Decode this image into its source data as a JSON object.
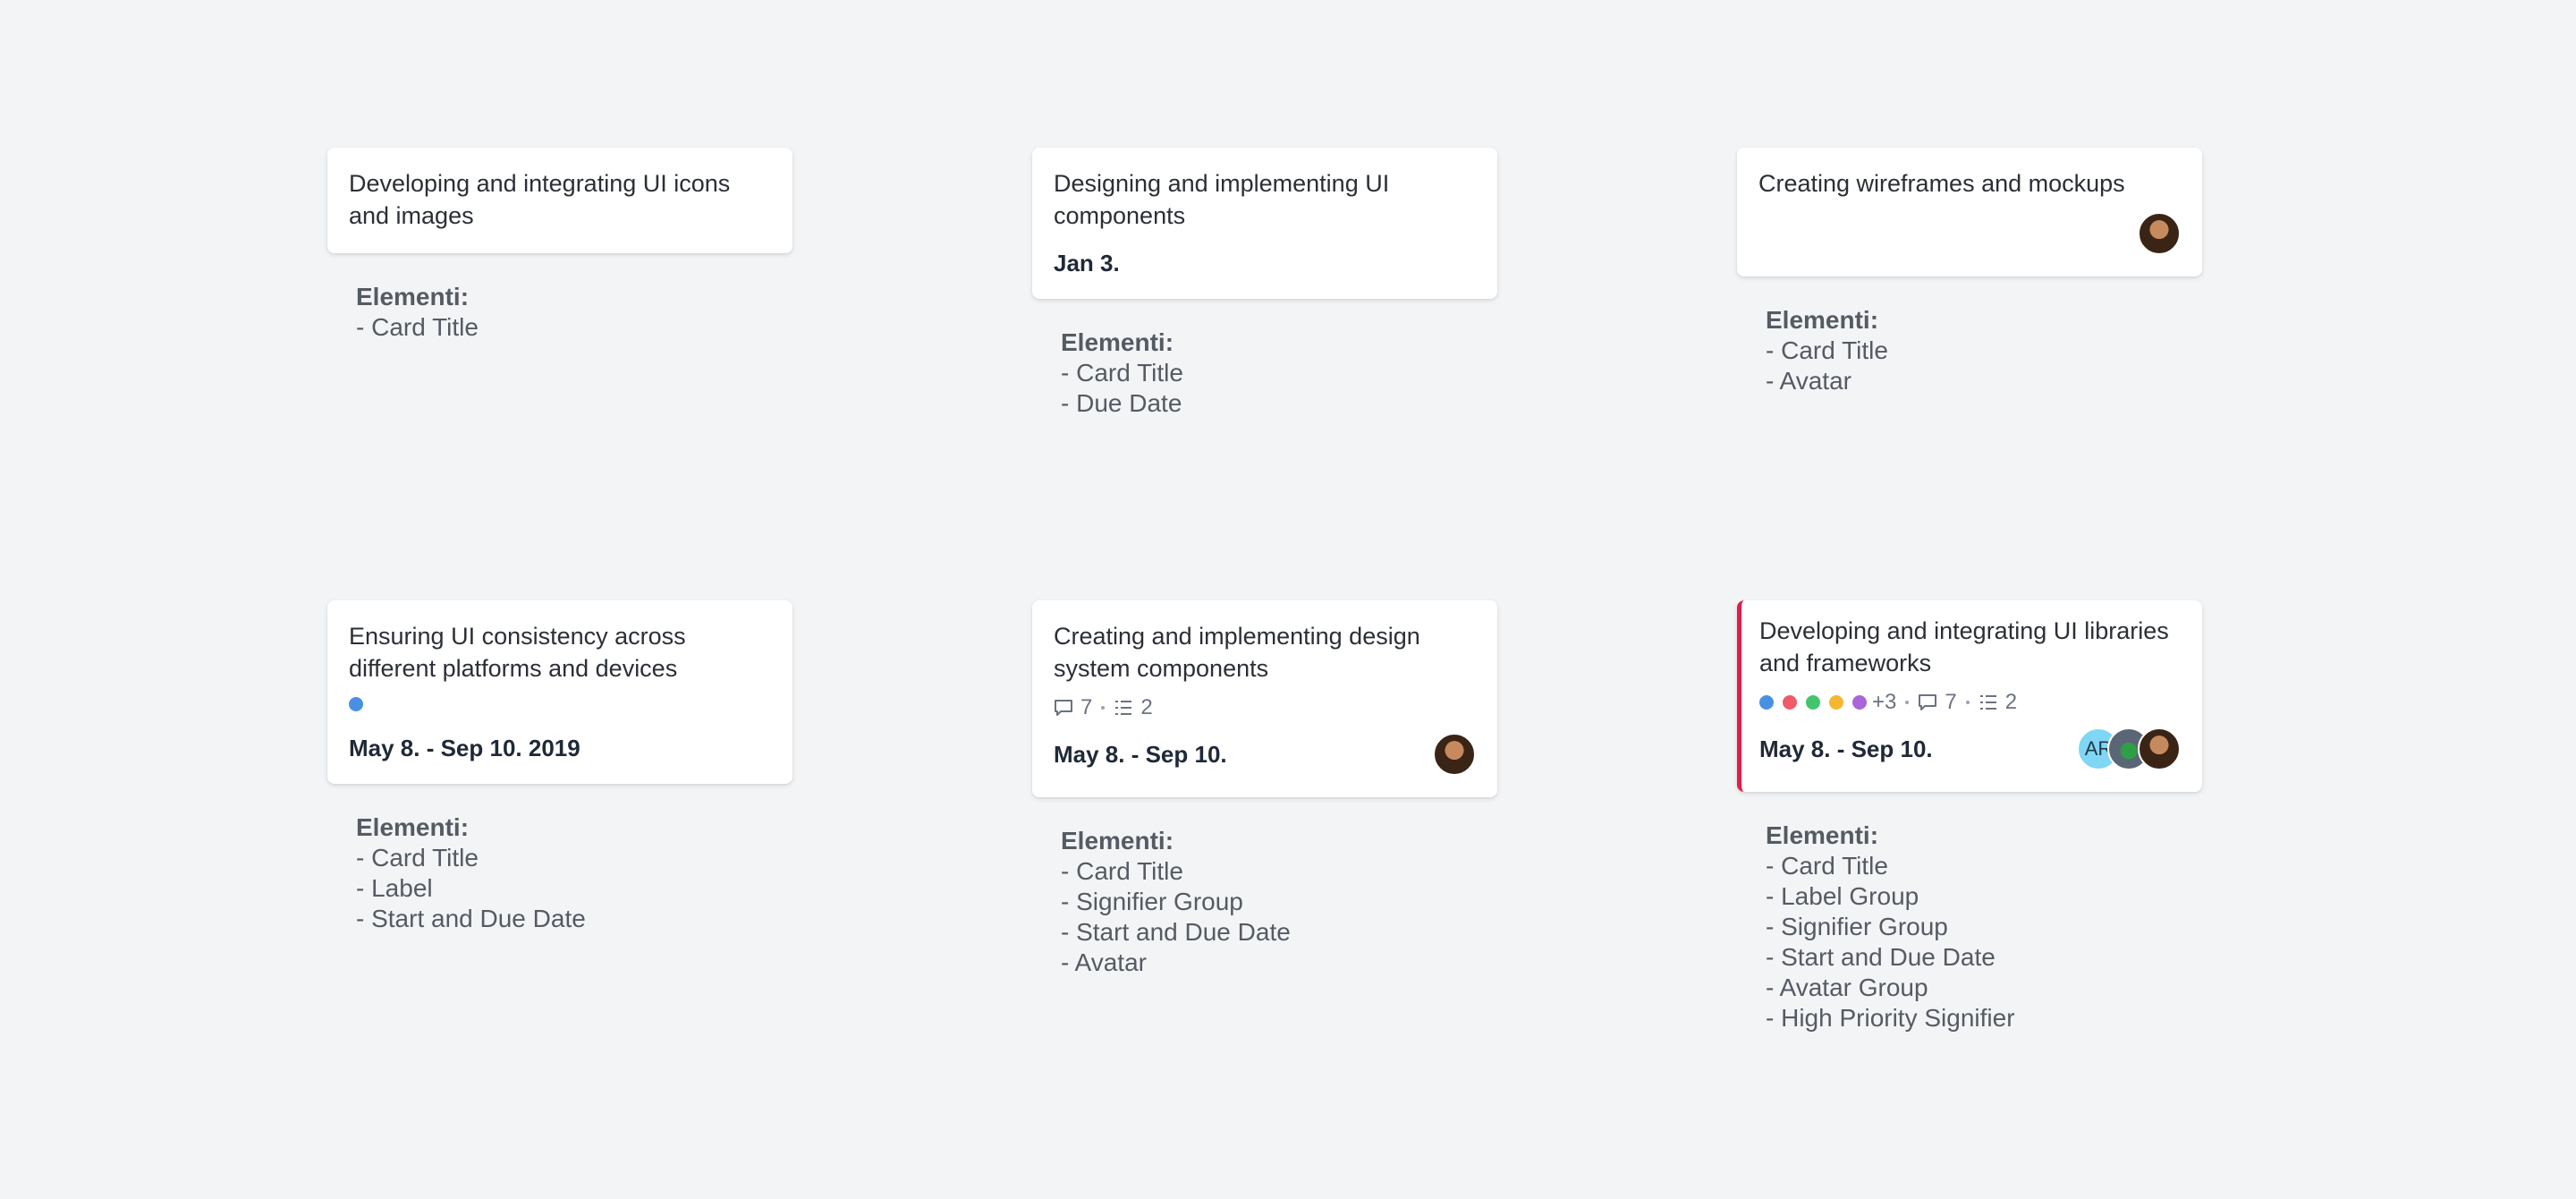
{
  "notes_heading": "Elementi:",
  "colors": {
    "priority": "#e11d48",
    "label_blue": "#4a90e2",
    "label_red": "#ef5b6a",
    "label_green": "#45c46e",
    "label_yellow": "#f5b731",
    "label_purple": "#a866d8"
  },
  "cards": [
    {
      "title": "Developing and integrating UI icons and images",
      "notes": [
        "- Card Title"
      ]
    },
    {
      "title": "Designing and implementing UI components",
      "due": "Jan 3.",
      "notes": [
        "- Card Title",
        "- Due Date"
      ]
    },
    {
      "title": "Creating wireframes and mockups",
      "avatar_icon": "person-avatar",
      "notes": [
        "- Card Title",
        "- Avatar"
      ]
    },
    {
      "title": "Ensuring UI consistency across different platforms and devices",
      "label_color": "#4a90e2",
      "due": "May 8. - Sep 10. 2019",
      "notes": [
        "- Card Title",
        "- Label",
        "- Start and Due Date"
      ]
    },
    {
      "title": "Creating and implementing design system components",
      "comments_count": "7",
      "checklist_count": "2",
      "due": "May 8. - Sep 10.",
      "avatar_icon": "person-avatar",
      "notes": [
        "- Card Title",
        "- Signifier Group",
        "- Start and Due Date",
        "- Avatar"
      ]
    },
    {
      "title": "Developing and integrating UI libraries and frameworks",
      "label_colors": [
        "#4a90e2",
        "#ef5b6a",
        "#45c46e",
        "#f5b731",
        "#a866d8"
      ],
      "labels_more": "+3",
      "comments_count": "7",
      "checklist_count": "2",
      "due": "May 8. - Sep 10.",
      "avatar_initials": "AR",
      "notes": [
        "- Card Title",
        "- Label Group",
        "- Signifier Group",
        "- Start and Due Date",
        "- Avatar Group",
        "- High Priority Signifier"
      ]
    }
  ]
}
